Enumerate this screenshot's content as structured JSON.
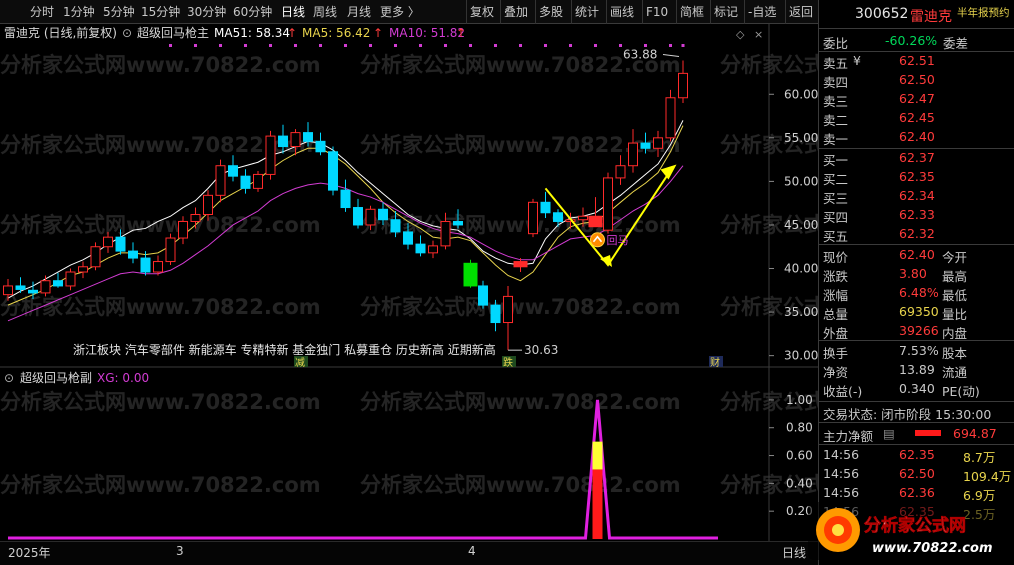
{
  "toolbar": {
    "left_items": [
      {
        "label": "分时",
        "active": false
      },
      {
        "label": "1分钟",
        "active": false
      },
      {
        "label": "5分钟",
        "active": false
      },
      {
        "label": "15分钟",
        "active": false
      },
      {
        "label": "30分钟",
        "active": false
      },
      {
        "label": "60分钟",
        "active": false
      },
      {
        "label": "日线",
        "active": true
      },
      {
        "label": "周线",
        "active": false
      },
      {
        "label": "月线",
        "active": false
      },
      {
        "label": "更多 〉",
        "active": false
      }
    ],
    "right_items": [
      "复权",
      "叠加",
      "多股",
      "统计",
      "画线",
      "F10",
      "简框",
      "标记",
      "-自选",
      "返回"
    ]
  },
  "main_chart": {
    "stock_title": "雷迪克 (日线,前复权)",
    "indicator_name": "超级回马枪主",
    "ma51": "MA51: 58.34",
    "ma5": "MA5: 56.42",
    "ma10": "MA10: 51.82",
    "arrow_glyph": "↑",
    "y_ticks": [
      "60.00",
      "55.00",
      "50.00",
      "45.00",
      "40.00",
      "35.00",
      "30.00"
    ],
    "high_label": "63.88",
    "low_label": "30.63",
    "buy_signal_text": "回马",
    "concept_tags": "浙江板块  汽车零部件  新能源车    专精特新  基金独门  私募重仓  历史新高  近期新高",
    "event_markers": {
      "m1": "减",
      "m2": "跌",
      "m3": "财"
    },
    "watermark": "分析家公式网www.70822.com",
    "colors": {
      "up": "#ff2a2a",
      "down": "#00d8ff",
      "ma51": "#ffffff",
      "ma5": "#e8d44d",
      "ma10": "#d23cd2",
      "arrow": "#ffff00"
    }
  },
  "chart_data": {
    "type": "candlestick",
    "title": "雷迪克 (日线,前复权)",
    "ylim": [
      29.5,
      66
    ],
    "high": 63.88,
    "low": 30.63,
    "candles": [
      {
        "o": 37.0,
        "h": 38.8,
        "l": 36.3,
        "c": 38.0
      },
      {
        "o": 38.0,
        "h": 39.0,
        "l": 37.2,
        "c": 37.6
      },
      {
        "o": 37.5,
        "h": 38.5,
        "l": 36.5,
        "c": 37.2
      },
      {
        "o": 37.2,
        "h": 39.2,
        "l": 36.8,
        "c": 38.6
      },
      {
        "o": 38.6,
        "h": 39.5,
        "l": 37.8,
        "c": 38.0
      },
      {
        "o": 38.0,
        "h": 40.0,
        "l": 37.5,
        "c": 39.6
      },
      {
        "o": 39.6,
        "h": 40.8,
        "l": 38.9,
        "c": 40.2
      },
      {
        "o": 40.2,
        "h": 43.0,
        "l": 39.8,
        "c": 42.5
      },
      {
        "o": 42.5,
        "h": 44.2,
        "l": 41.8,
        "c": 43.6
      },
      {
        "o": 43.6,
        "h": 44.5,
        "l": 41.6,
        "c": 42.0
      },
      {
        "o": 42.0,
        "h": 43.0,
        "l": 40.6,
        "c": 41.2
      },
      {
        "o": 41.2,
        "h": 42.0,
        "l": 39.2,
        "c": 39.6
      },
      {
        "o": 39.6,
        "h": 41.5,
        "l": 39.2,
        "c": 40.8
      },
      {
        "o": 40.8,
        "h": 44.0,
        "l": 40.4,
        "c": 43.5
      },
      {
        "o": 43.5,
        "h": 46.0,
        "l": 42.8,
        "c": 45.4
      },
      {
        "o": 45.4,
        "h": 47.0,
        "l": 44.6,
        "c": 46.2
      },
      {
        "o": 46.2,
        "h": 49.0,
        "l": 45.5,
        "c": 48.4
      },
      {
        "o": 48.4,
        "h": 52.5,
        "l": 47.6,
        "c": 51.8
      },
      {
        "o": 51.8,
        "h": 53.0,
        "l": 50.0,
        "c": 50.6
      },
      {
        "o": 50.6,
        "h": 51.4,
        "l": 48.6,
        "c": 49.2
      },
      {
        "o": 49.2,
        "h": 51.2,
        "l": 48.8,
        "c": 50.8
      },
      {
        "o": 50.8,
        "h": 55.8,
        "l": 50.2,
        "c": 55.2
      },
      {
        "o": 55.2,
        "h": 56.5,
        "l": 53.2,
        "c": 54.0
      },
      {
        "o": 54.0,
        "h": 56.0,
        "l": 53.0,
        "c": 55.6
      },
      {
        "o": 55.6,
        "h": 56.8,
        "l": 54.0,
        "c": 54.6
      },
      {
        "o": 54.6,
        "h": 55.6,
        "l": 53.0,
        "c": 53.4
      },
      {
        "o": 53.4,
        "h": 54.0,
        "l": 48.4,
        "c": 49.0
      },
      {
        "o": 49.0,
        "h": 50.2,
        "l": 46.5,
        "c": 47.0
      },
      {
        "o": 47.0,
        "h": 48.0,
        "l": 44.6,
        "c": 45.0
      },
      {
        "o": 45.0,
        "h": 47.2,
        "l": 44.4,
        "c": 46.8
      },
      {
        "o": 46.8,
        "h": 47.6,
        "l": 45.0,
        "c": 45.6
      },
      {
        "o": 45.6,
        "h": 46.6,
        "l": 43.6,
        "c": 44.2
      },
      {
        "o": 44.2,
        "h": 45.2,
        "l": 42.2,
        "c": 42.8
      },
      {
        "o": 42.8,
        "h": 43.8,
        "l": 41.4,
        "c": 41.8
      },
      {
        "o": 41.8,
        "h": 43.2,
        "l": 41.2,
        "c": 42.6
      },
      {
        "o": 42.6,
        "h": 46.4,
        "l": 42.2,
        "c": 45.4
      },
      {
        "o": 45.4,
        "h": 46.8,
        "l": 44.6,
        "c": 45.0
      },
      {
        "o": 40.6,
        "h": 41.0,
        "l": 37.8,
        "c": 38.0
      },
      {
        "o": 38.0,
        "h": 38.6,
        "l": 35.4,
        "c": 35.8
      },
      {
        "o": 35.8,
        "h": 36.4,
        "l": 32.8,
        "c": 33.8
      },
      {
        "o": 33.8,
        "h": 38.0,
        "l": 30.63,
        "c": 36.8
      },
      {
        "o": 40.2,
        "h": 41.2,
        "l": 39.6,
        "c": 40.8
      },
      {
        "o": 44.0,
        "h": 48.0,
        "l": 43.6,
        "c": 47.6
      },
      {
        "o": 47.6,
        "h": 48.8,
        "l": 45.8,
        "c": 46.4
      },
      {
        "o": 46.4,
        "h": 46.8,
        "l": 44.8,
        "c": 45.4
      },
      {
        "o": 45.4,
        "h": 46.4,
        "l": 44.6,
        "c": 45.6
      },
      {
        "o": 45.6,
        "h": 47.0,
        "l": 44.8,
        "c": 46.0
      },
      {
        "o": 46.0,
        "h": 48.2,
        "l": 45.6,
        "c": 44.8
      },
      {
        "o": 44.4,
        "h": 51.0,
        "l": 44.0,
        "c": 50.4
      },
      {
        "o": 50.4,
        "h": 53.0,
        "l": 49.6,
        "c": 51.8
      },
      {
        "o": 51.8,
        "h": 56.0,
        "l": 51.0,
        "c": 54.4
      },
      {
        "o": 54.4,
        "h": 55.6,
        "l": 53.2,
        "c": 53.8
      },
      {
        "o": 53.8,
        "h": 55.8,
        "l": 52.8,
        "c": 55.0
      },
      {
        "o": 55.0,
        "h": 60.5,
        "l": 54.6,
        "c": 59.6
      },
      {
        "o": 59.6,
        "h": 63.88,
        "l": 59.0,
        "c": 62.4
      }
    ],
    "ma_values": {
      "MA51": [
        36.6,
        37.4,
        38.0,
        38.8,
        39.6,
        40.4,
        41.0,
        41.8,
        42.8,
        43.6,
        44.4,
        44.6,
        45.4,
        46.0,
        47.0,
        47.8,
        49.2,
        50.8,
        51.4,
        51.8,
        52.2,
        53.0,
        53.4,
        54.0,
        54.6,
        54.4,
        53.6,
        52.4,
        51.0,
        49.8,
        48.6,
        47.4,
        46.2,
        45.4,
        44.9,
        44.6,
        44.4,
        43.4,
        42.0,
        41.2,
        40.6,
        40.4,
        40.6,
        43.4,
        45.0,
        45.8,
        46.0,
        46.4,
        47.4,
        48.4,
        49.6,
        50.8,
        52.0,
        54.2,
        57.0
      ],
      "MA5": [
        35.8,
        36.4,
        37.0,
        37.6,
        38.4,
        39.2,
        39.6,
        40.4,
        41.2,
        41.8,
        41.8,
        41.6,
        41.8,
        42.6,
        43.8,
        45.0,
        46.4,
        47.8,
        48.6,
        49.4,
        50.2,
        51.4,
        52.4,
        53.2,
        53.8,
        53.8,
        53.0,
        52.0,
        50.6,
        49.2,
        47.6,
        46.4,
        45.4,
        44.6,
        43.6,
        43.4,
        43.6,
        43.2,
        41.8,
        40.4,
        39.2,
        38.6,
        39.6,
        41.6,
        43.6,
        44.8,
        45.2,
        45.4,
        46.4,
        47.6,
        48.8,
        49.8,
        51.0,
        53.4,
        56.4
      ],
      "MA10": [
        34.0,
        34.6,
        35.2,
        35.8,
        36.4,
        37.0,
        37.6,
        38.2,
        38.8,
        39.4,
        39.6,
        39.4,
        39.4,
        39.8,
        40.6,
        41.6,
        42.6,
        43.8,
        45.0,
        45.8,
        46.6,
        47.8,
        48.6,
        49.2,
        49.6,
        49.8,
        49.6,
        49.2,
        48.6,
        48.2,
        47.6,
        46.8,
        46.0,
        45.2,
        44.6,
        44.2,
        44.0,
        43.6,
        42.8,
        42.0,
        41.4,
        41.0,
        41.0,
        41.8,
        42.6,
        43.4,
        43.6,
        43.8,
        44.6,
        45.6,
        46.6,
        47.4,
        48.4,
        50.0,
        51.8
      ]
    },
    "sub_chart": {
      "name": "超级回马枪副",
      "xg_label": "XG: 0.00",
      "y_ticks": [
        "1.00",
        "0.80",
        "0.60",
        "0.40",
        "0.20"
      ],
      "ylim": [
        0,
        1.1
      ],
      "signal_index": 47,
      "signal_value": 1.0,
      "bar_segments": [
        {
          "from": 0,
          "to": 0.5,
          "color": "#ff1a1a"
        },
        {
          "from": 0.5,
          "to": 0.7,
          "color": "#ffff33"
        }
      ]
    },
    "x_labels": [
      {
        "label": "2025年",
        "index": 0
      },
      {
        "label": "3",
        "index": 14
      },
      {
        "label": "4",
        "index": 38
      }
    ]
  },
  "bottom_bar": {
    "date_label": "2025年",
    "month3": "3",
    "month4": "4",
    "period": "日线"
  },
  "quote_panel": {
    "code": "300652",
    "name": "雷迪克",
    "badge": "半年报预约",
    "weibi_label": "委比",
    "weibi_value": "-60.26%",
    "weicha_label": "委差",
    "sell": [
      {
        "label": "卖五",
        "price": "62.51",
        "extra": "¥"
      },
      {
        "label": "卖四",
        "price": "62.50"
      },
      {
        "label": "卖三",
        "price": "62.47"
      },
      {
        "label": "卖二",
        "price": "62.45"
      },
      {
        "label": "卖一",
        "price": "62.40"
      }
    ],
    "buy": [
      {
        "label": "买一",
        "price": "62.37"
      },
      {
        "label": "买二",
        "price": "62.35"
      },
      {
        "label": "买三",
        "price": "62.34"
      },
      {
        "label": "买四",
        "price": "62.33"
      },
      {
        "label": "买五",
        "price": "62.32"
      }
    ],
    "stats": [
      {
        "l": "现价",
        "v": "62.40",
        "l2": "今开"
      },
      {
        "l": "涨跌",
        "v": "3.80",
        "l2": "最高"
      },
      {
        "l": "涨幅",
        "v": "6.48%",
        "l2": "最低"
      },
      {
        "l": "总量",
        "v": "69350",
        "l2": "量比"
      },
      {
        "l": "外盘",
        "v": "39266",
        "l2": "内盘"
      }
    ],
    "stats2": [
      {
        "l": "换手",
        "v": "7.53%",
        "l2": "股本"
      },
      {
        "l": "净资",
        "v": "13.89",
        "l2": "流通"
      },
      {
        "l": "收益(-)",
        "v": "0.340",
        "l2": "PE(动)"
      }
    ],
    "trade_status": "交易状态: 闭市阶段  15:30:00",
    "main_net_label": "主力净额",
    "main_net_value": "694.87",
    "ticks": [
      {
        "time": "14:56",
        "price": "62.35",
        "vol": "8.7万"
      },
      {
        "time": "14:56",
        "price": "62.50",
        "vol": "109.4万"
      },
      {
        "time": "14:56",
        "price": "62.36",
        "vol": "6.9万"
      },
      {
        "time": "14:56",
        "price": "62.35",
        "vol": "2.5万"
      }
    ]
  },
  "logo": {
    "text": "分析家公式网",
    "url": "www.70822.com"
  }
}
